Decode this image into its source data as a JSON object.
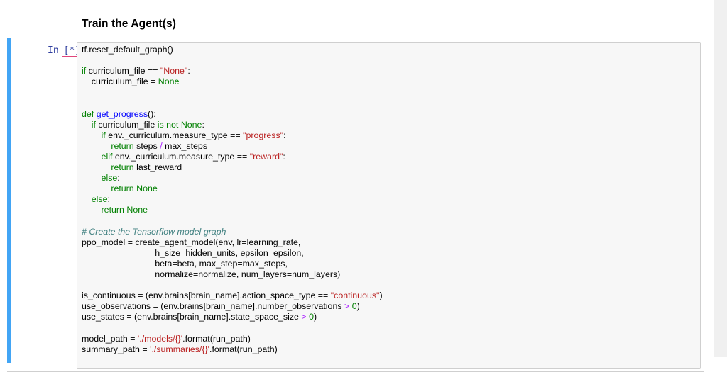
{
  "heading": "Train the Agent(s)",
  "cell": {
    "prompt_in": "In",
    "prompt_count": "[*]:",
    "lines": [
      [
        {
          "t": "tf.reset_default_graph()",
          "c": ""
        }
      ],
      [],
      [
        {
          "t": "if",
          "c": "kw"
        },
        {
          "t": " curriculum_file == ",
          "c": ""
        },
        {
          "t": "\"None\"",
          "c": "str"
        },
        {
          "t": ":",
          "c": ""
        }
      ],
      [
        {
          "t": "    curriculum_file = ",
          "c": ""
        },
        {
          "t": "None",
          "c": "kw"
        }
      ],
      [],
      [],
      [
        {
          "t": "def",
          "c": "kw"
        },
        {
          "t": " ",
          "c": ""
        },
        {
          "t": "get_progress",
          "c": "fn"
        },
        {
          "t": "():",
          "c": ""
        }
      ],
      [
        {
          "t": "    ",
          "c": ""
        },
        {
          "t": "if",
          "c": "kw"
        },
        {
          "t": " curriculum_file ",
          "c": ""
        },
        {
          "t": "is not",
          "c": "kw"
        },
        {
          "t": " ",
          "c": ""
        },
        {
          "t": "None",
          "c": "kw"
        },
        {
          "t": ":",
          "c": ""
        }
      ],
      [
        {
          "t": "        ",
          "c": ""
        },
        {
          "t": "if",
          "c": "kw"
        },
        {
          "t": " env._curriculum.measure_type == ",
          "c": ""
        },
        {
          "t": "\"progress\"",
          "c": "str"
        },
        {
          "t": ":",
          "c": ""
        }
      ],
      [
        {
          "t": "            ",
          "c": ""
        },
        {
          "t": "return",
          "c": "kw"
        },
        {
          "t": " steps ",
          "c": ""
        },
        {
          "t": "/",
          "c": "op"
        },
        {
          "t": " max_steps",
          "c": ""
        }
      ],
      [
        {
          "t": "        ",
          "c": ""
        },
        {
          "t": "elif",
          "c": "kw"
        },
        {
          "t": " env._curriculum.measure_type == ",
          "c": ""
        },
        {
          "t": "\"reward\"",
          "c": "str"
        },
        {
          "t": ":",
          "c": ""
        }
      ],
      [
        {
          "t": "            ",
          "c": ""
        },
        {
          "t": "return",
          "c": "kw"
        },
        {
          "t": " last_reward",
          "c": ""
        }
      ],
      [
        {
          "t": "        ",
          "c": ""
        },
        {
          "t": "else",
          "c": "kw"
        },
        {
          "t": ":",
          "c": ""
        }
      ],
      [
        {
          "t": "            ",
          "c": ""
        },
        {
          "t": "return",
          "c": "kw"
        },
        {
          "t": " ",
          "c": ""
        },
        {
          "t": "None",
          "c": "kw"
        }
      ],
      [
        {
          "t": "    ",
          "c": ""
        },
        {
          "t": "else",
          "c": "kw"
        },
        {
          "t": ":",
          "c": ""
        }
      ],
      [
        {
          "t": "        ",
          "c": ""
        },
        {
          "t": "return",
          "c": "kw"
        },
        {
          "t": " ",
          "c": ""
        },
        {
          "t": "None",
          "c": "kw"
        }
      ],
      [],
      [
        {
          "t": "# Create the Tensorflow model graph",
          "c": "cm"
        }
      ],
      [
        {
          "t": "ppo_model = create_agent_model(env, lr=learning_rate,",
          "c": ""
        }
      ],
      [
        {
          "t": "                              h_size=hidden_units, epsilon=epsilon,",
          "c": ""
        }
      ],
      [
        {
          "t": "                              beta=beta, max_step=max_steps,",
          "c": ""
        }
      ],
      [
        {
          "t": "                              normalize=normalize, num_layers=num_layers)",
          "c": ""
        }
      ],
      [],
      [
        {
          "t": "is_continuous = (env.brains[brain_name].action_space_type == ",
          "c": ""
        },
        {
          "t": "\"continuous\"",
          "c": "str"
        },
        {
          "t": ")",
          "c": ""
        }
      ],
      [
        {
          "t": "use_observations = (env.brains[brain_name].number_observations ",
          "c": ""
        },
        {
          "t": ">",
          "c": "op"
        },
        {
          "t": " ",
          "c": ""
        },
        {
          "t": "0",
          "c": "num"
        },
        {
          "t": ")",
          "c": ""
        }
      ],
      [
        {
          "t": "use_states = (env.brains[brain_name].state_space_size ",
          "c": ""
        },
        {
          "t": ">",
          "c": "op"
        },
        {
          "t": " ",
          "c": ""
        },
        {
          "t": "0",
          "c": "num"
        },
        {
          "t": ")",
          "c": ""
        }
      ],
      [],
      [
        {
          "t": "model_path = ",
          "c": ""
        },
        {
          "t": "'./models/{}'",
          "c": "str"
        },
        {
          "t": ".format(run_path)",
          "c": ""
        }
      ],
      [
        {
          "t": "summary_path = ",
          "c": ""
        },
        {
          "t": "'./summaries/{}'",
          "c": "str"
        },
        {
          "t": ".format(run_path)",
          "c": ""
        }
      ]
    ]
  }
}
